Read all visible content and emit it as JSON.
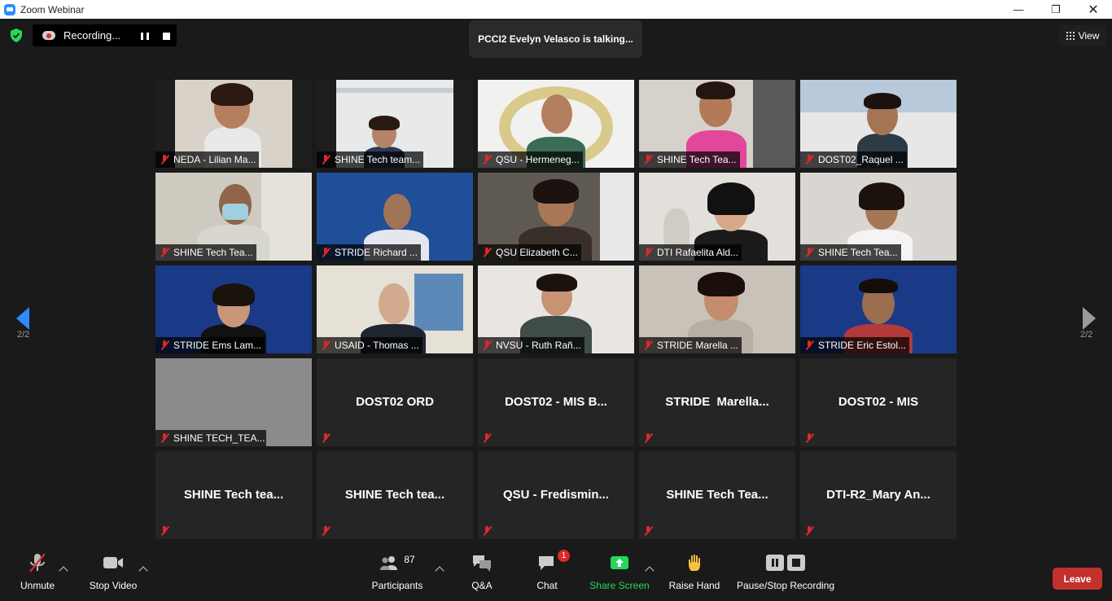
{
  "window": {
    "title": "Zoom Webinar"
  },
  "recording": {
    "label": "Recording..."
  },
  "talking": {
    "text": "PCCI2 Evelyn Velasco is talking..."
  },
  "view": {
    "label": "View"
  },
  "pager": {
    "left_label": "2/2",
    "right_label": "2/2"
  },
  "tiles": [
    {
      "name": "NEDA - Lilian Ma..."
    },
    {
      "name": "SHINE Tech team..."
    },
    {
      "name": "QSU - Hermeneg..."
    },
    {
      "name": "SHINE Tech Tea..."
    },
    {
      "name": "DOST02_Raquel ..."
    },
    {
      "name": "SHINE Tech Tea..."
    },
    {
      "name": "STRIDE Richard ..."
    },
    {
      "name": "QSU Elizabeth C..."
    },
    {
      "name": "DTI Rafaelita Ald..."
    },
    {
      "name": "SHINE Tech Tea..."
    },
    {
      "name": "STRIDE Ems Lam..."
    },
    {
      "name": "USAID - Thomas ..."
    },
    {
      "name": "NVSU - Ruth Rañ..."
    },
    {
      "name": "STRIDE Marella ..."
    },
    {
      "name": "STRIDE Eric Estol..."
    },
    {
      "name": "SHINE TECH_TEA..."
    },
    {
      "name": "DOST02 ORD"
    },
    {
      "name": "DOST02 - MIS B..."
    },
    {
      "name": "STRIDE  Marella..."
    },
    {
      "name": "DOST02 - MIS"
    },
    {
      "name": "SHINE Tech tea..."
    },
    {
      "name": "SHINE Tech tea..."
    },
    {
      "name": "QSU - Fredismin..."
    },
    {
      "name": "SHINE Tech Tea..."
    },
    {
      "name": "DTI-R2_Mary An..."
    }
  ],
  "toolbar": {
    "unmute": "Unmute",
    "stop_video": "Stop Video",
    "participants": "Participants",
    "participants_count": "87",
    "qa": "Q&A",
    "chat": "Chat",
    "chat_badge": "1",
    "share_screen": "Share Screen",
    "raise_hand": "Raise Hand",
    "pause_stop_recording": "Pause/Stop Recording",
    "leave": "Leave"
  },
  "colors": {
    "accent_green": "#23d959",
    "leave_red": "#c4302b",
    "muted_red": "#e02828",
    "nav_blue": "#2d8cff"
  }
}
